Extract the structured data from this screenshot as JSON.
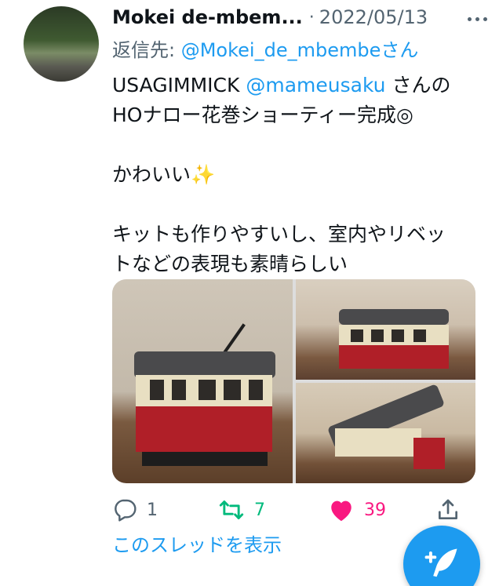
{
  "tweet": {
    "display_name": "Mokei de-mbem...",
    "separator": "·",
    "date": "2022/05/13",
    "reply_label": "返信先: ",
    "reply_handle": "@Mokei_de_mbembeさん",
    "lines": {
      "l1_pre": "USAGIMMICK ",
      "l1_mention": "@mameusaku",
      "l1_post": " さんの",
      "l2": "HOナロー花巻ショーティー完成◎",
      "l3_text": "かわいい",
      "l3_emoji": "✨",
      "l4": "キットも作りやすいし、室内やリベッ",
      "l5": "トなどの表現も素晴らしい"
    }
  },
  "actions": {
    "reply_count": "1",
    "retweet_count": "7",
    "like_count": "39"
  },
  "thread_link": "このスレッドを表示",
  "colors": {
    "accent": "#1d9bf0",
    "retweet": "#00ba7c",
    "like": "#f91880",
    "muted": "#536471"
  },
  "icons": {
    "more": "more-dots-icon",
    "reply": "reply-bubble-icon",
    "retweet": "retweet-arrows-icon",
    "like": "heart-filled-icon",
    "share": "share-upload-icon",
    "compose": "compose-feather-icon"
  }
}
